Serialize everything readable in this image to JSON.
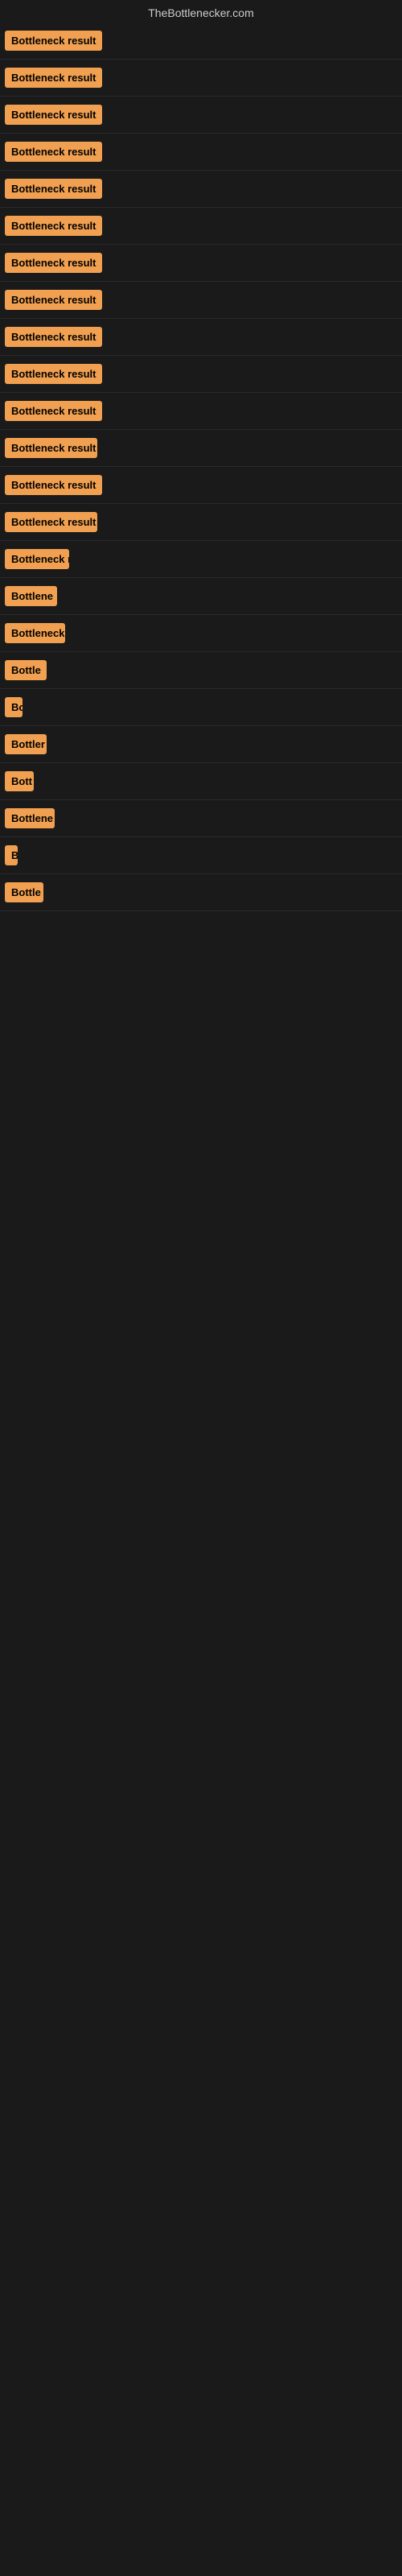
{
  "site": {
    "title": "TheBottlenecker.com"
  },
  "rows": [
    {
      "id": 1,
      "label": "Bottleneck result",
      "width": 130
    },
    {
      "id": 2,
      "label": "Bottleneck result",
      "width": 130
    },
    {
      "id": 3,
      "label": "Bottleneck result",
      "width": 130
    },
    {
      "id": 4,
      "label": "Bottleneck result",
      "width": 130
    },
    {
      "id": 5,
      "label": "Bottleneck result",
      "width": 130
    },
    {
      "id": 6,
      "label": "Bottleneck result",
      "width": 130
    },
    {
      "id": 7,
      "label": "Bottleneck result",
      "width": 130
    },
    {
      "id": 8,
      "label": "Bottleneck result",
      "width": 130
    },
    {
      "id": 9,
      "label": "Bottleneck result",
      "width": 130
    },
    {
      "id": 10,
      "label": "Bottleneck result",
      "width": 130
    },
    {
      "id": 11,
      "label": "Bottleneck result",
      "width": 130
    },
    {
      "id": 12,
      "label": "Bottleneck result",
      "width": 115
    },
    {
      "id": 13,
      "label": "Bottleneck result",
      "width": 130
    },
    {
      "id": 14,
      "label": "Bottleneck result",
      "width": 115
    },
    {
      "id": 15,
      "label": "Bottleneck r",
      "width": 80
    },
    {
      "id": 16,
      "label": "Bottlene",
      "width": 65
    },
    {
      "id": 17,
      "label": "Bottleneck",
      "width": 75
    },
    {
      "id": 18,
      "label": "Bottle",
      "width": 52
    },
    {
      "id": 19,
      "label": "Bo",
      "width": 22
    },
    {
      "id": 20,
      "label": "Bottler",
      "width": 52
    },
    {
      "id": 21,
      "label": "Bott",
      "width": 36
    },
    {
      "id": 22,
      "label": "Bottlene",
      "width": 62
    },
    {
      "id": 23,
      "label": "B",
      "width": 14
    },
    {
      "id": 24,
      "label": "Bottle",
      "width": 48
    }
  ]
}
